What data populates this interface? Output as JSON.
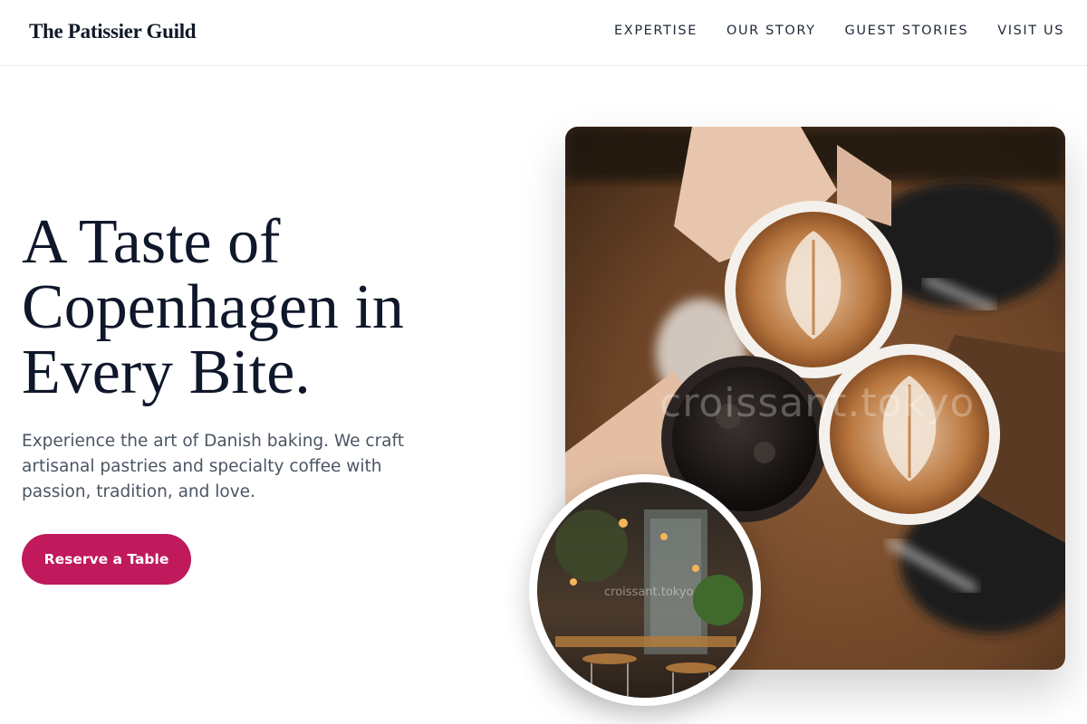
{
  "navbar": {
    "brand": "The Patissier Guild",
    "links": [
      {
        "label": "EXPERTISE"
      },
      {
        "label": "OUR STORY"
      },
      {
        "label": "GUEST STORIES"
      },
      {
        "label": "VISIT US"
      }
    ]
  },
  "hero": {
    "title_lines": [
      "A Taste of",
      "Copenhagen in",
      "Every Bite."
    ],
    "subtitle": "Experience the art of Danish baking. We craft artisanal pastries and specialty coffee with passion, tradition, and love.",
    "cta_label": "Reserve a Table"
  },
  "images": {
    "main_watermark": "croissant.tokyo",
    "inset_watermark": "croissant.tokyo"
  },
  "colors": {
    "accent": "#c0195c",
    "heading": "#0f172a",
    "body_text": "#4b5563"
  }
}
